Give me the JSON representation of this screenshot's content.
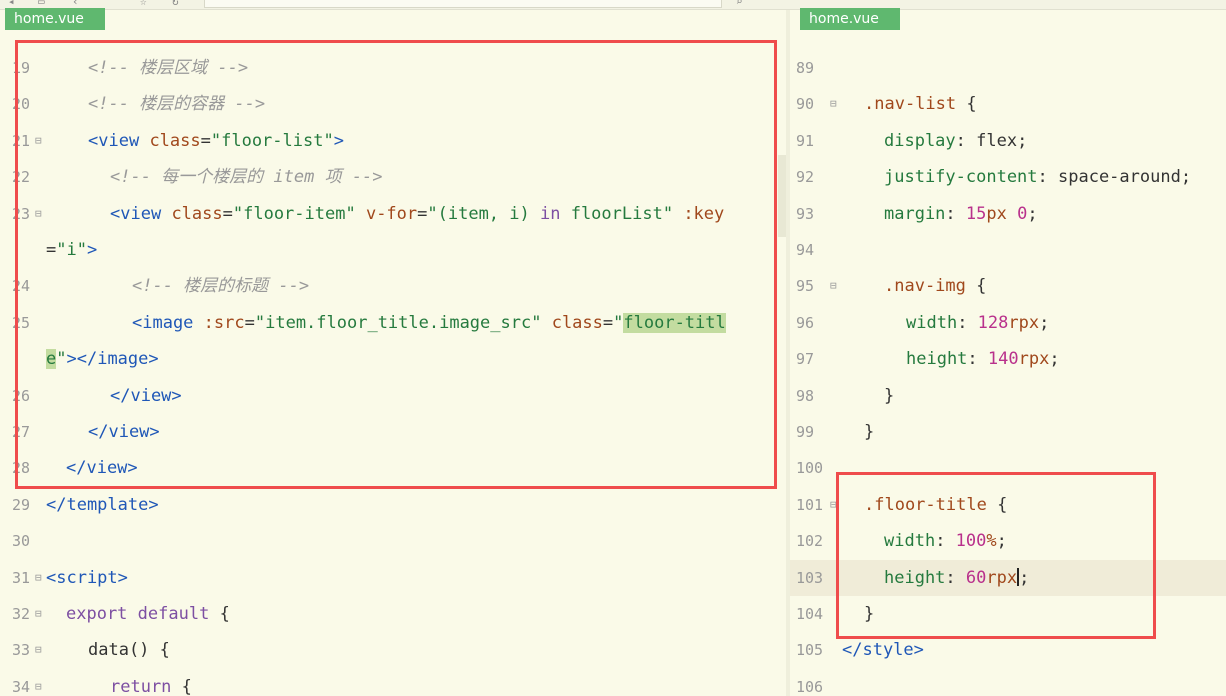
{
  "left_tab": "home.vue",
  "right_tab": "home.vue",
  "left_lines": [
    {
      "num": "19",
      "html": "<span class=\"cm\">&lt;!-- 楼层区域 --&gt;</span>",
      "indent": 88,
      "fold": false
    },
    {
      "num": "20",
      "html": "<span class=\"cm\">&lt;!-- 楼层的容器 --&gt;</span>",
      "indent": 88,
      "fold": false
    },
    {
      "num": "21",
      "html": "<span class=\"tg\">&lt;view</span> <span class=\"at\">class</span>=<span class=\"st\">\"floor-list\"</span><span class=\"tg\">&gt;</span>",
      "indent": 88,
      "fold": true
    },
    {
      "num": "22",
      "html": "<span class=\"cm\">&lt;!-- 每一个楼层的 item 项 --&gt;</span>",
      "indent": 110,
      "fold": false
    },
    {
      "num": "23",
      "html": "<span class=\"tg\">&lt;view</span> <span class=\"at\">class</span>=<span class=\"st\">\"floor-item\"</span> <span class=\"at\">v-for</span>=<span class=\"st\">\"(item, i) <span class=\"kw\">in</span> floorList\"</span> <span class=\"at\">:key</span>",
      "indent": 110,
      "fold": true
    },
    {
      "num": "",
      "html": "=<span class=\"st\">\"i\"</span><span class=\"tg\">&gt;</span>",
      "indent": 46,
      "fold": false
    },
    {
      "num": "24",
      "html": "<span class=\"cm\">&lt;!-- 楼层的标题 --&gt;</span>",
      "indent": 132,
      "fold": false
    },
    {
      "num": "25",
      "html": "<span class=\"tg\">&lt;image</span> <span class=\"at\">:src</span>=<span class=\"st\">\"item.floor_title.image_src\"</span> <span class=\"at\">class</span>=<span class=\"st\">\"<span class=\"hl\">floor-titl</span></span>",
      "indent": 132,
      "fold": false
    },
    {
      "num": "",
      "html": "<span class=\"st\"><span class=\"hl\">e</span>\"</span><span class=\"tg\">&gt;&lt;/image&gt;</span>",
      "indent": 46,
      "fold": false
    },
    {
      "num": "26",
      "html": "<span class=\"tg\">&lt;/view&gt;</span>",
      "indent": 110,
      "fold": false
    },
    {
      "num": "27",
      "html": "<span class=\"tg\">&lt;/view&gt;</span>",
      "indent": 88,
      "fold": false
    },
    {
      "num": "28",
      "html": "<span class=\"tg\">&lt;/view&gt;</span>",
      "indent": 66,
      "fold": false
    },
    {
      "num": "29",
      "html": "<span class=\"tg\">&lt;/template&gt;</span>",
      "indent": 46,
      "fold": false
    },
    {
      "num": "30",
      "html": "",
      "indent": 46,
      "fold": false
    },
    {
      "num": "31",
      "html": "<span class=\"tg\">&lt;script&gt;</span>",
      "indent": 46,
      "fold": true
    },
    {
      "num": "32",
      "html": "<span class=\"kw\">export</span> <span class=\"kw\">default</span> {",
      "indent": 66,
      "fold": true
    },
    {
      "num": "33",
      "html": "data() {",
      "indent": 88,
      "fold": true
    },
    {
      "num": "34",
      "html": "<span class=\"kw\">return</span> {",
      "indent": 110,
      "fold": true
    }
  ],
  "right_lines": [
    {
      "num": "89",
      "html": "",
      "indent": 864,
      "fold": false
    },
    {
      "num": "90",
      "html": "<span class=\"sel\">.nav-list</span> {",
      "indent": 864,
      "fold": true
    },
    {
      "num": "91",
      "html": "<span class=\"pr\">display</span>: flex;",
      "indent": 884,
      "fold": false
    },
    {
      "num": "92",
      "html": "<span class=\"pr\">justify-content</span>: space-around;",
      "indent": 884,
      "fold": false
    },
    {
      "num": "93",
      "html": "<span class=\"pr\">margin</span>: <span class=\"nm\">15</span><span class=\"un\">px</span> <span class=\"nm\">0</span>;",
      "indent": 884,
      "fold": false
    },
    {
      "num": "94",
      "html": "",
      "indent": 884,
      "fold": false
    },
    {
      "num": "95",
      "html": "<span class=\"sel\">.nav-img</span> {",
      "indent": 884,
      "fold": true
    },
    {
      "num": "96",
      "html": "<span class=\"pr\">width</span>: <span class=\"nm\">128</span><span class=\"un\">rpx</span>;",
      "indent": 906,
      "fold": false
    },
    {
      "num": "97",
      "html": "<span class=\"pr\">height</span>: <span class=\"nm\">140</span><span class=\"un\">rpx</span>;",
      "indent": 906,
      "fold": false
    },
    {
      "num": "98",
      "html": "}",
      "indent": 884,
      "fold": false
    },
    {
      "num": "99",
      "html": "}",
      "indent": 864,
      "fold": false
    },
    {
      "num": "100",
      "html": "",
      "indent": 864,
      "fold": false
    },
    {
      "num": "101",
      "html": "<span class=\"sel\">.floor-title</span> {",
      "indent": 864,
      "fold": true
    },
    {
      "num": "102",
      "html": "<span class=\"pr\">width</span>: <span class=\"nm\">100</span><span class=\"un\">%</span>;",
      "indent": 884,
      "fold": false
    },
    {
      "num": "103",
      "html": "<span class=\"pr\">height</span>: <span class=\"nm\">60</span><span class=\"un\">rpx</span><span class=\"caret\"></span>;",
      "indent": 884,
      "fold": false,
      "current": true
    },
    {
      "num": "104",
      "html": "}",
      "indent": 864,
      "fold": false
    },
    {
      "num": "105",
      "html": "<span class=\"tg\">&lt;/style&gt;</span>",
      "indent": 842,
      "fold": false
    },
    {
      "num": "106",
      "html": "",
      "indent": 842,
      "fold": false
    }
  ]
}
